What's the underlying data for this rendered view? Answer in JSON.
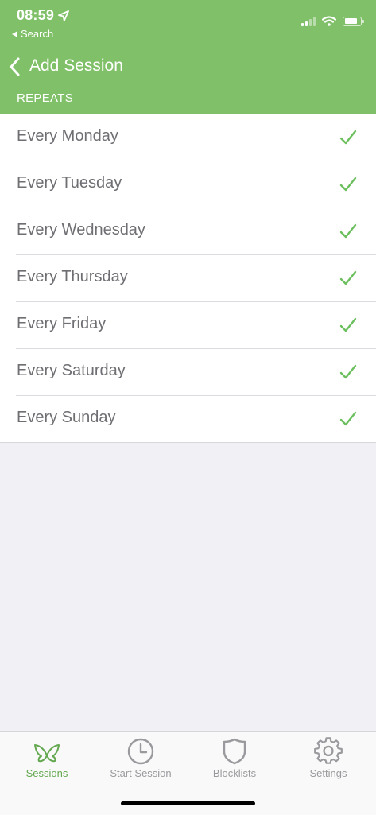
{
  "status_bar": {
    "time": "08:59",
    "back_app": "Search",
    "battery_fraction": 0.85
  },
  "nav": {
    "title": "Add Session"
  },
  "section": {
    "header": "REPEATS"
  },
  "days": [
    {
      "label": "Every Monday",
      "checked": true
    },
    {
      "label": "Every Tuesday",
      "checked": true
    },
    {
      "label": "Every Wednesday",
      "checked": true
    },
    {
      "label": "Every Thursday",
      "checked": true
    },
    {
      "label": "Every Friday",
      "checked": true
    },
    {
      "label": "Every Saturday",
      "checked": true
    },
    {
      "label": "Every Sunday",
      "checked": true
    }
  ],
  "tabs": [
    {
      "label": "Sessions",
      "icon": "butterfly-icon",
      "active": true
    },
    {
      "label": "Start Session",
      "icon": "clock-icon",
      "active": false
    },
    {
      "label": "Blocklists",
      "icon": "shield-icon",
      "active": false
    },
    {
      "label": "Settings",
      "icon": "gear-icon",
      "active": false
    }
  ],
  "colors": {
    "header_green": "#80c068",
    "accent_green": "#63a84f",
    "checkmark_green": "#6cbf5e",
    "inactive_gray": "#9a9a9e"
  }
}
